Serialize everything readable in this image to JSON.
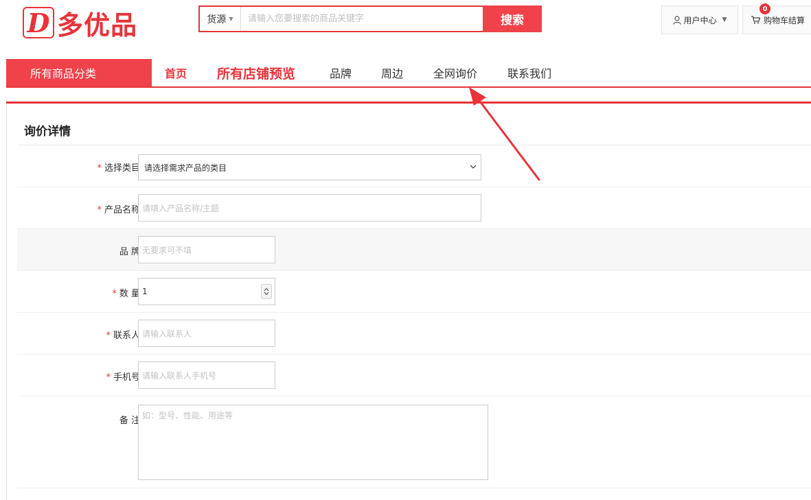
{
  "header": {
    "logo_letter": "D",
    "logo_text": "多优品",
    "search": {
      "type_label": "货源",
      "placeholder": "请输入您要搜索的商品关键字",
      "button_label": "搜索"
    },
    "user_center_label": "用户中心",
    "cart_label": "购物车结算",
    "cart_count": "0"
  },
  "nav": {
    "category_label": "所有商品分类",
    "items": [
      {
        "label": "首页"
      },
      {
        "label": "所有店铺预览"
      },
      {
        "label": "品牌"
      },
      {
        "label": "周边"
      },
      {
        "label": "全网询价"
      },
      {
        "label": "联系我们"
      }
    ]
  },
  "form": {
    "title": "询价详情",
    "category": {
      "label": "选择类目",
      "required_mark": "*",
      "value": "请选择需求产品的类目"
    },
    "product_name": {
      "label": "产品名称",
      "required_mark": "*",
      "placeholder": "请填入产品名称/主题"
    },
    "brand": {
      "label": "品 牌",
      "placeholder": "无要求可不填"
    },
    "quantity": {
      "label": "数 量",
      "required_mark": "*",
      "value": "1"
    },
    "contact": {
      "label": "联系人",
      "required_mark": "*",
      "placeholder": "请输入联系人"
    },
    "phone": {
      "label": "手机号",
      "required_mark": "*",
      "placeholder": "请输入联系人手机号"
    },
    "remark": {
      "label": "备 注",
      "placeholder": "如：型号、性能、用途等"
    }
  },
  "colors": {
    "accent": "#e8333a",
    "button": "#f0424a"
  }
}
